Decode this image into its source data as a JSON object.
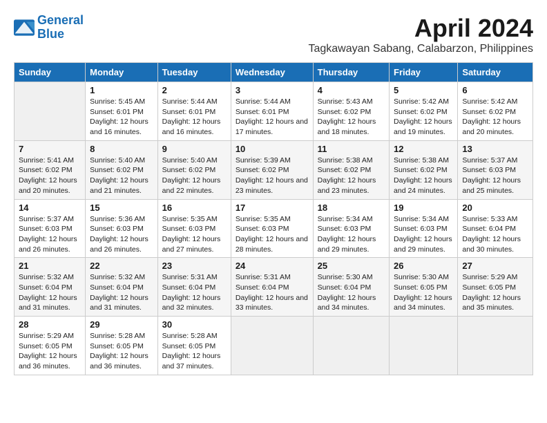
{
  "logo": {
    "line1": "General",
    "line2": "Blue"
  },
  "title": "April 2024",
  "subtitle": "Tagkawayan Sabang, Calabarzon, Philippines",
  "days_header": [
    "Sunday",
    "Monday",
    "Tuesday",
    "Wednesday",
    "Thursday",
    "Friday",
    "Saturday"
  ],
  "weeks": [
    [
      {
        "day": "",
        "sunrise": "",
        "sunset": "",
        "daylight": ""
      },
      {
        "day": "1",
        "sunrise": "Sunrise: 5:45 AM",
        "sunset": "Sunset: 6:01 PM",
        "daylight": "Daylight: 12 hours and 16 minutes."
      },
      {
        "day": "2",
        "sunrise": "Sunrise: 5:44 AM",
        "sunset": "Sunset: 6:01 PM",
        "daylight": "Daylight: 12 hours and 16 minutes."
      },
      {
        "day": "3",
        "sunrise": "Sunrise: 5:44 AM",
        "sunset": "Sunset: 6:01 PM",
        "daylight": "Daylight: 12 hours and 17 minutes."
      },
      {
        "day": "4",
        "sunrise": "Sunrise: 5:43 AM",
        "sunset": "Sunset: 6:02 PM",
        "daylight": "Daylight: 12 hours and 18 minutes."
      },
      {
        "day": "5",
        "sunrise": "Sunrise: 5:42 AM",
        "sunset": "Sunset: 6:02 PM",
        "daylight": "Daylight: 12 hours and 19 minutes."
      },
      {
        "day": "6",
        "sunrise": "Sunrise: 5:42 AM",
        "sunset": "Sunset: 6:02 PM",
        "daylight": "Daylight: 12 hours and 20 minutes."
      }
    ],
    [
      {
        "day": "7",
        "sunrise": "Sunrise: 5:41 AM",
        "sunset": "Sunset: 6:02 PM",
        "daylight": "Daylight: 12 hours and 20 minutes."
      },
      {
        "day": "8",
        "sunrise": "Sunrise: 5:40 AM",
        "sunset": "Sunset: 6:02 PM",
        "daylight": "Daylight: 12 hours and 21 minutes."
      },
      {
        "day": "9",
        "sunrise": "Sunrise: 5:40 AM",
        "sunset": "Sunset: 6:02 PM",
        "daylight": "Daylight: 12 hours and 22 minutes."
      },
      {
        "day": "10",
        "sunrise": "Sunrise: 5:39 AM",
        "sunset": "Sunset: 6:02 PM",
        "daylight": "Daylight: 12 hours and 23 minutes."
      },
      {
        "day": "11",
        "sunrise": "Sunrise: 5:38 AM",
        "sunset": "Sunset: 6:02 PM",
        "daylight": "Daylight: 12 hours and 23 minutes."
      },
      {
        "day": "12",
        "sunrise": "Sunrise: 5:38 AM",
        "sunset": "Sunset: 6:02 PM",
        "daylight": "Daylight: 12 hours and 24 minutes."
      },
      {
        "day": "13",
        "sunrise": "Sunrise: 5:37 AM",
        "sunset": "Sunset: 6:03 PM",
        "daylight": "Daylight: 12 hours and 25 minutes."
      }
    ],
    [
      {
        "day": "14",
        "sunrise": "Sunrise: 5:37 AM",
        "sunset": "Sunset: 6:03 PM",
        "daylight": "Daylight: 12 hours and 26 minutes."
      },
      {
        "day": "15",
        "sunrise": "Sunrise: 5:36 AM",
        "sunset": "Sunset: 6:03 PM",
        "daylight": "Daylight: 12 hours and 26 minutes."
      },
      {
        "day": "16",
        "sunrise": "Sunrise: 5:35 AM",
        "sunset": "Sunset: 6:03 PM",
        "daylight": "Daylight: 12 hours and 27 minutes."
      },
      {
        "day": "17",
        "sunrise": "Sunrise: 5:35 AM",
        "sunset": "Sunset: 6:03 PM",
        "daylight": "Daylight: 12 hours and 28 minutes."
      },
      {
        "day": "18",
        "sunrise": "Sunrise: 5:34 AM",
        "sunset": "Sunset: 6:03 PM",
        "daylight": "Daylight: 12 hours and 29 minutes."
      },
      {
        "day": "19",
        "sunrise": "Sunrise: 5:34 AM",
        "sunset": "Sunset: 6:03 PM",
        "daylight": "Daylight: 12 hours and 29 minutes."
      },
      {
        "day": "20",
        "sunrise": "Sunrise: 5:33 AM",
        "sunset": "Sunset: 6:04 PM",
        "daylight": "Daylight: 12 hours and 30 minutes."
      }
    ],
    [
      {
        "day": "21",
        "sunrise": "Sunrise: 5:32 AM",
        "sunset": "Sunset: 6:04 PM",
        "daylight": "Daylight: 12 hours and 31 minutes."
      },
      {
        "day": "22",
        "sunrise": "Sunrise: 5:32 AM",
        "sunset": "Sunset: 6:04 PM",
        "daylight": "Daylight: 12 hours and 31 minutes."
      },
      {
        "day": "23",
        "sunrise": "Sunrise: 5:31 AM",
        "sunset": "Sunset: 6:04 PM",
        "daylight": "Daylight: 12 hours and 32 minutes."
      },
      {
        "day": "24",
        "sunrise": "Sunrise: 5:31 AM",
        "sunset": "Sunset: 6:04 PM",
        "daylight": "Daylight: 12 hours and 33 minutes."
      },
      {
        "day": "25",
        "sunrise": "Sunrise: 5:30 AM",
        "sunset": "Sunset: 6:04 PM",
        "daylight": "Daylight: 12 hours and 34 minutes."
      },
      {
        "day": "26",
        "sunrise": "Sunrise: 5:30 AM",
        "sunset": "Sunset: 6:05 PM",
        "daylight": "Daylight: 12 hours and 34 minutes."
      },
      {
        "day": "27",
        "sunrise": "Sunrise: 5:29 AM",
        "sunset": "Sunset: 6:05 PM",
        "daylight": "Daylight: 12 hours and 35 minutes."
      }
    ],
    [
      {
        "day": "28",
        "sunrise": "Sunrise: 5:29 AM",
        "sunset": "Sunset: 6:05 PM",
        "daylight": "Daylight: 12 hours and 36 minutes."
      },
      {
        "day": "29",
        "sunrise": "Sunrise: 5:28 AM",
        "sunset": "Sunset: 6:05 PM",
        "daylight": "Daylight: 12 hours and 36 minutes."
      },
      {
        "day": "30",
        "sunrise": "Sunrise: 5:28 AM",
        "sunset": "Sunset: 6:05 PM",
        "daylight": "Daylight: 12 hours and 37 minutes."
      },
      {
        "day": "",
        "sunrise": "",
        "sunset": "",
        "daylight": ""
      },
      {
        "day": "",
        "sunrise": "",
        "sunset": "",
        "daylight": ""
      },
      {
        "day": "",
        "sunrise": "",
        "sunset": "",
        "daylight": ""
      },
      {
        "day": "",
        "sunrise": "",
        "sunset": "",
        "daylight": ""
      }
    ]
  ]
}
